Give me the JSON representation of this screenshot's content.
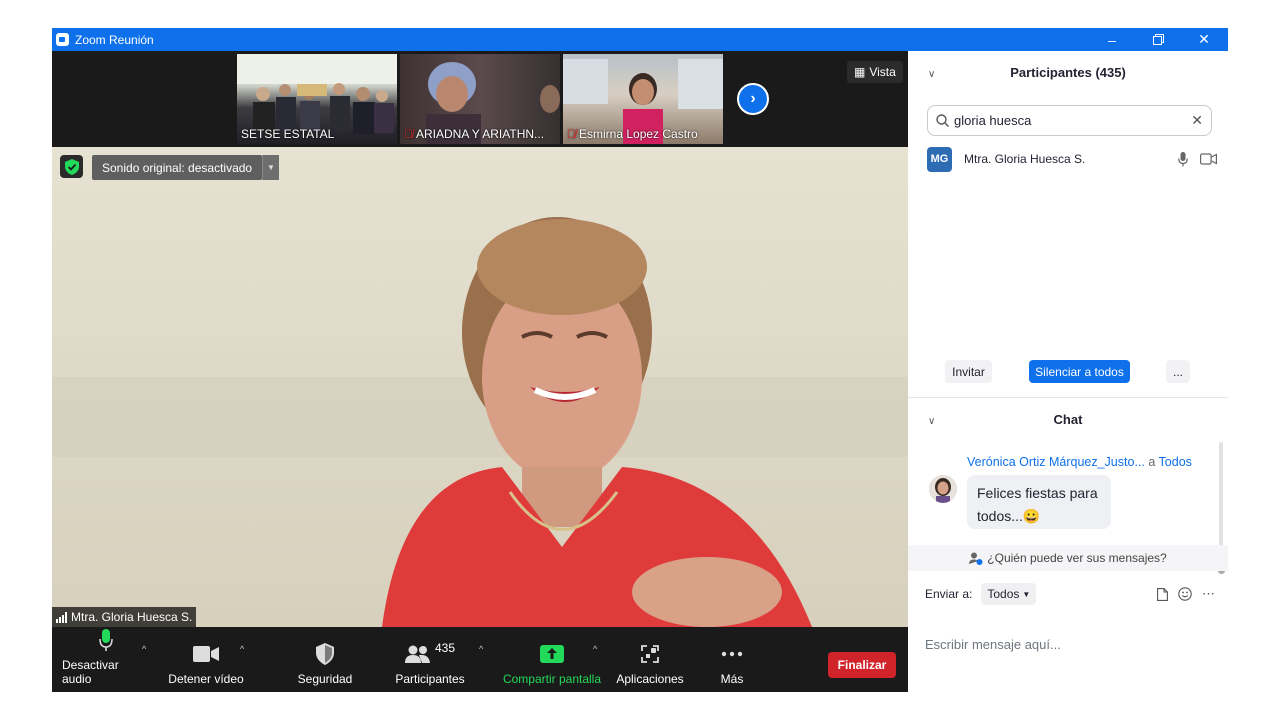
{
  "window": {
    "title": "Zoom Reunión"
  },
  "gallery": {
    "tiles": [
      {
        "name": "SETSE ESTATAL",
        "muted": false
      },
      {
        "name": "ARIADNA Y ARIATHN...",
        "muted": true
      },
      {
        "name": "Esmirna Lopez Castro",
        "muted": true
      }
    ],
    "view_label": "Vista"
  },
  "main_video": {
    "speaker_name": "Mtra. Gloria Huesca S.",
    "original_sound_label": "Sonido original: desactivado"
  },
  "toolbar": {
    "audio_label": "Desactivar audio",
    "video_label": "Detener vídeo",
    "security_label": "Seguridad",
    "participants_label": "Participantes",
    "participants_count": "435",
    "share_label": "Compartir pantalla",
    "apps_label": "Aplicaciones",
    "more_label": "Más",
    "end_label": "Finalizar"
  },
  "participants_panel": {
    "title": "Participantes (435)",
    "search_value": "gloria huesca",
    "results": [
      {
        "initials": "MG",
        "name": "Mtra. Gloria Huesca S."
      }
    ],
    "invite_label": "Invitar",
    "mute_all_label": "Silenciar a todos",
    "more_label": "..."
  },
  "chat": {
    "title": "Chat",
    "messages": [
      {
        "sender": "Verónica Ortiz Márquez_Justo...",
        "to_prefix": "a",
        "to": "Todos",
        "line1": "Felices fiestas para",
        "line2": "todos...",
        "emoji": "😀"
      }
    ],
    "who_can_see": "¿Quién puede ver sus mensajes?",
    "send_to_label": "Enviar a:",
    "send_to_value": "Todos",
    "compose_placeholder": "Escribir mensaje aquí..."
  },
  "colors": {
    "accent": "#0e71eb",
    "end": "#d1242a",
    "share": "#23d959"
  }
}
